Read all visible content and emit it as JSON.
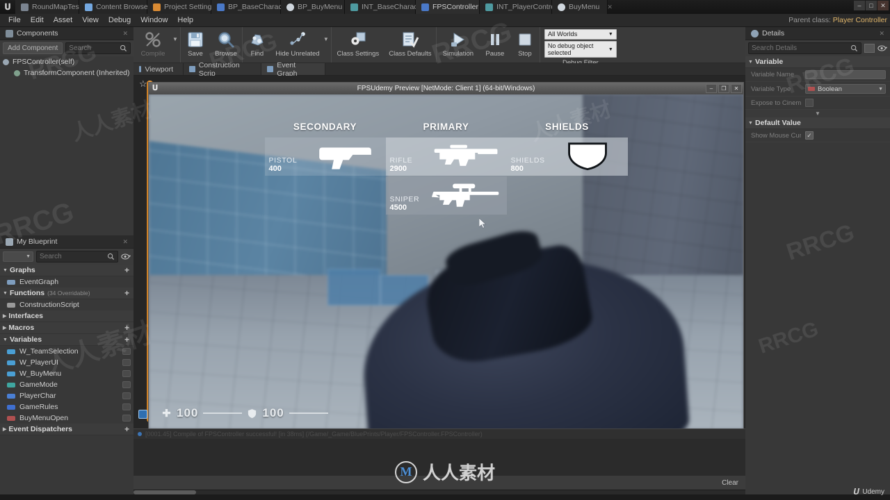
{
  "window": {
    "title": "Unreal Engine Blueprint Editor",
    "parent_class_label": "Parent class:",
    "parent_class_value": "Player Controller",
    "minimize": "–",
    "maximize": "□",
    "close": "✕"
  },
  "tabs": [
    {
      "label": "RoundMapTest",
      "icon": "level-icon",
      "active": false
    },
    {
      "label": "Content Browser",
      "icon": "content-browser-icon",
      "active": false
    },
    {
      "label": "Project Settings",
      "icon": "settings-icon",
      "active": false
    },
    {
      "label": "BP_BaseCharacter",
      "icon": "blueprint-icon",
      "active": false
    },
    {
      "label": "BP_BuyMenu",
      "icon": "widget-icon",
      "active": false
    },
    {
      "label": "INT_BaseCharacter",
      "icon": "interface-icon",
      "active": false
    },
    {
      "label": "FPSController",
      "icon": "blueprint-icon",
      "active": true
    },
    {
      "label": "INT_PlayerController",
      "icon": "interface-icon",
      "active": false
    },
    {
      "label": "BuyMenu",
      "icon": "widget-icon",
      "active": false
    }
  ],
  "menu": [
    "File",
    "Edit",
    "Asset",
    "View",
    "Debug",
    "Window",
    "Help"
  ],
  "components_panel": {
    "tab_label": "Components",
    "add_component_label": "Add Component",
    "search_placeholder": "Search",
    "tree": [
      {
        "label": "FPSController(self)",
        "indent": 0
      },
      {
        "label": "TransformComponent (Inherited)",
        "indent": 1
      }
    ]
  },
  "my_blueprint": {
    "tab_label": "My Blueprint",
    "search_placeholder": "Search",
    "sections": [
      {
        "label": "Graphs",
        "sub": "",
        "plus": "+",
        "collapsed": false,
        "items": [
          {
            "label": "EventGraph",
            "color": "#7e9dbe"
          }
        ]
      },
      {
        "label": "Functions",
        "sub": "(34 Overridable)",
        "plus": "+",
        "collapsed": false,
        "items": [
          {
            "label": "ConstructionScript",
            "color": "#9a9a9a"
          }
        ]
      },
      {
        "label": "Interfaces",
        "sub": "",
        "plus": "",
        "collapsed": true,
        "items": []
      },
      {
        "label": "Macros",
        "sub": "",
        "plus": "+",
        "collapsed": true,
        "items": []
      },
      {
        "label": "Variables",
        "sub": "",
        "plus": "+",
        "collapsed": false,
        "items": [
          {
            "label": "W_TeamSelection",
            "color": "#4a9fd4"
          },
          {
            "label": "W_PlayerUI",
            "color": "#4a9fd4"
          },
          {
            "label": "W_BuyMenu",
            "color": "#4a9fd4"
          },
          {
            "label": "GameMode",
            "color": "#3fa6a0"
          },
          {
            "label": "PlayerChar",
            "color": "#4a7fd4"
          },
          {
            "label": "GameRules",
            "color": "#3f6fd0"
          },
          {
            "label": "BuyMenuOpen",
            "color": "#b05050"
          }
        ]
      },
      {
        "label": "Event Dispatchers",
        "sub": "",
        "plus": "+",
        "collapsed": true,
        "items": []
      }
    ]
  },
  "toolbar": {
    "buttons": [
      {
        "label": "Compile",
        "icon": "compile-icon",
        "disabled": true,
        "caret": true
      },
      {
        "label": "Save",
        "icon": "save-icon",
        "disabled": false,
        "caret": false
      },
      {
        "label": "Browse",
        "icon": "browse-icon",
        "disabled": false,
        "caret": false
      },
      {
        "label": "Find",
        "icon": "find-icon",
        "disabled": false,
        "caret": false
      },
      {
        "label": "Hide Unrelated",
        "icon": "hide-unrelated-icon",
        "disabled": false,
        "caret": true
      },
      {
        "label": "Class Settings",
        "icon": "class-settings-icon",
        "disabled": false,
        "caret": false
      },
      {
        "label": "Class Defaults",
        "icon": "class-defaults-icon",
        "disabled": false,
        "caret": false
      },
      {
        "label": "Simulation",
        "icon": "play-icon",
        "disabled": false,
        "caret": false
      },
      {
        "label": "Pause",
        "icon": "pause-icon",
        "disabled": false,
        "caret": false
      },
      {
        "label": "Stop",
        "icon": "stop-icon",
        "disabled": false,
        "caret": false
      }
    ],
    "debug_filter": {
      "world_value": "All Worlds",
      "object_value": "No debug object selected",
      "label": "Debug Filter"
    }
  },
  "graph_tabs": [
    {
      "label": "Viewport",
      "icon": "viewport-icon",
      "active": false
    },
    {
      "label": "Construction Scrip",
      "icon": "function-icon",
      "active": false
    },
    {
      "label": "Event Graph",
      "icon": "event-graph-icon",
      "active": true
    }
  ],
  "details_panel": {
    "tab_label": "Details",
    "search_placeholder": "Search Details",
    "sections": [
      {
        "label": "Variable",
        "rows": [
          {
            "label": "Variable Name",
            "type": "text",
            "value": ""
          },
          {
            "label": "Variable Type",
            "type": "dropdown",
            "value": "Boolean"
          },
          {
            "label": "Expose to Cinem",
            "type": "checkbox",
            "value": ""
          }
        ]
      },
      {
        "label": "Default Value",
        "rows": [
          {
            "label": "Show Mouse Cur",
            "type": "checkbox-checked",
            "value": ""
          }
        ]
      }
    ]
  },
  "game_window": {
    "title": "FPSUdemy Preview [NetMode: Client 1] (64-bit/Windows)",
    "minimize": "–",
    "maximize": "❐",
    "close": "✕"
  },
  "buy_menu": {
    "columns": [
      {
        "title": "SECONDARY",
        "items": [
          {
            "name": "PISTOL",
            "price": "400",
            "art": "pistol-icon",
            "state": "dim"
          }
        ]
      },
      {
        "title": "PRIMARY",
        "items": [
          {
            "name": "RIFLE",
            "price": "2900",
            "art": "rifle-icon",
            "state": "normal"
          },
          {
            "name": "SNIPER",
            "price": "4500",
            "art": "sniper-icon",
            "state": "sel"
          }
        ]
      },
      {
        "title": "SHIELDS",
        "items": [
          {
            "name": "SHIELDS",
            "price": "800",
            "art": "shield-icon",
            "state": "normal"
          }
        ]
      }
    ]
  },
  "hud": {
    "health_value": "100",
    "health_icon": "health-cross-icon",
    "armor_value": "100",
    "armor_icon": "shield-icon"
  },
  "compiler_results": {
    "log_line": "[0001.45] Compile of FPSController successful! [in 38ms] (/Game/_Game/BluePrints/Player/FPSController.FPSController)",
    "clear_label": "Clear"
  },
  "branding": {
    "udemy_label": "Udemy",
    "watermark_center": "人人素材",
    "watermark_tile": "RRCG"
  },
  "colors": {
    "accent_orange": "#f2a54a",
    "panel_bg": "#383838",
    "toolbar_bg": "#3a3a3a",
    "parent_class": "#e0b56a"
  }
}
